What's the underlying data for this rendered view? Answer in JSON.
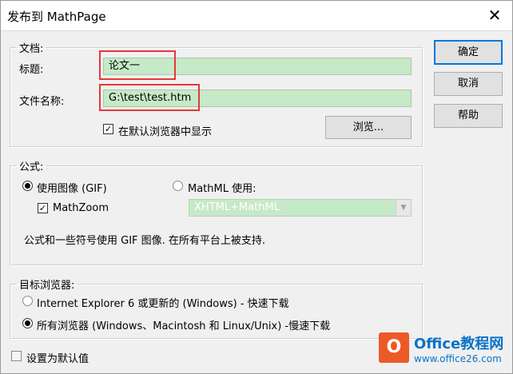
{
  "window": {
    "title": "发布到 MathPage",
    "close_glyph": "✕"
  },
  "document_group": {
    "legend": "文档:",
    "title_label": "标题:",
    "title_value": "论文一",
    "filename_label": "文件名称:",
    "filename_value": "G:\\test\\test.htm",
    "show_in_browser_label": "在默认浏览器中显示",
    "show_in_browser_checked": true,
    "browse_button": "浏览..."
  },
  "formula_group": {
    "legend": "公式:",
    "use_image_label": "使用图像 (GIF)",
    "use_image_selected": true,
    "mathml_label": "MathML 使用:",
    "mathml_selected": false,
    "mathzoom_label": "MathZoom",
    "mathzoom_checked": true,
    "mathml_select_value": "XHTML+MathML",
    "description": "公式和一些符号使用 GIF 图像. 在所有平台上被支持."
  },
  "browser_group": {
    "legend": "目标浏览器:",
    "option_ie": "Internet Explorer 6 或更新的 (Windows) - 快速下载",
    "option_ie_selected": false,
    "option_all": "所有浏览器 (Windows、Macintosh 和 Linux/Unix) -慢速下载",
    "option_all_selected": true
  },
  "set_default_label": "设置为默认值",
  "set_default_checked": false,
  "buttons": {
    "ok": "确定",
    "cancel": "取消",
    "help": "帮助"
  },
  "watermark": {
    "badge": "O",
    "name": "Office教程网",
    "url": "www.office26.com"
  },
  "colors": {
    "input_bg": "#c6e9c7",
    "highlight_box": "#e53935",
    "default_button_border": "#0078d7",
    "logo_orange": "#ec5a27",
    "logo_blue": "#0b72c8"
  }
}
